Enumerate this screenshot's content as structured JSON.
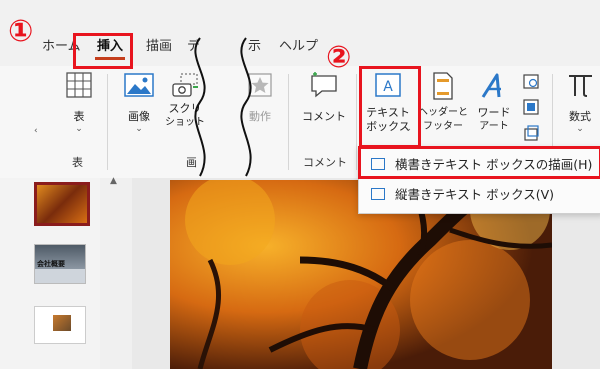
{
  "tabs": [
    {
      "label": "ホーム",
      "active": false
    },
    {
      "label": "挿入",
      "active": true
    },
    {
      "label": "描画",
      "active": false
    },
    {
      "label": "デ",
      "active": false
    },
    {
      "label": "示",
      "active": false
    },
    {
      "label": "ヘルプ",
      "active": false
    }
  ],
  "ribbon": {
    "table": {
      "button": "表",
      "group": "表"
    },
    "image": {
      "button": "画像"
    },
    "screenshot": {
      "line1": "スクリ",
      "line2": "ショット"
    },
    "image_group": "画",
    "action": {
      "button": "動作"
    },
    "comment": {
      "button": "コメント",
      "group": "コメント"
    },
    "textbox": {
      "line1": "テキスト",
      "line2": "ボックス"
    },
    "header_footer": {
      "line1": "ヘッダーと",
      "line2": "フッター"
    },
    "wordart": {
      "line1": "ワード",
      "line2": "アート"
    },
    "equation": {
      "button": "数式"
    }
  },
  "dropdown": {
    "items": [
      {
        "label": "横書きテキスト ボックスの描画(H)"
      },
      {
        "label": "縦書きテキスト ボックス(V)"
      }
    ]
  },
  "annotations": {
    "step1": "①",
    "step2": "②",
    "color": "#e8141e"
  },
  "thumbnails": [
    {
      "caption": "会社概要"
    }
  ],
  "colors": {
    "accent_tab": "#c43e1c",
    "icon_blue": "#2b78c8",
    "highlight_red": "#e8141e"
  }
}
